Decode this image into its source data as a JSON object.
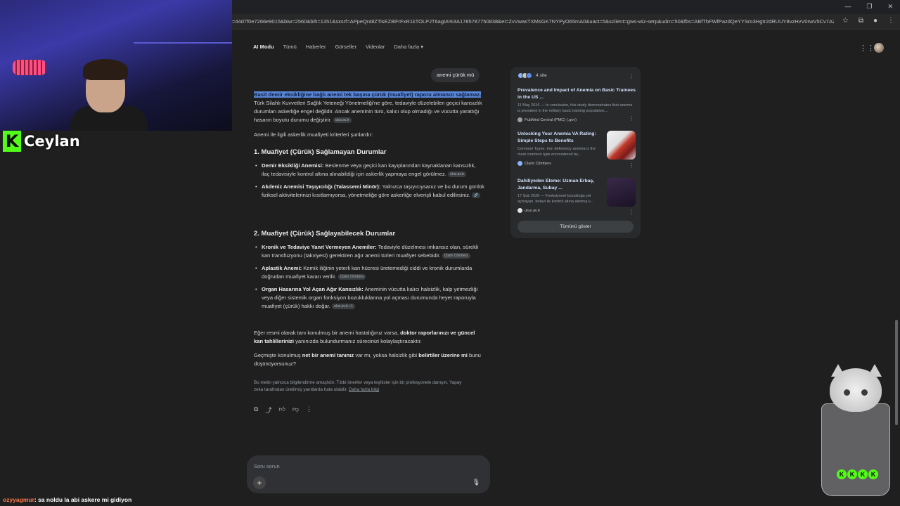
{
  "browser": {
    "url": "=44d7f0e7266e9015&biw=2560&bih=1351&sxsrf=APpeQnt8ZTisEZ8iFrFxR1kTOLPJT6agtA%3A1785787750838&ei=ZvVwasTXMsGK7NYPyO65mA0&uact=5&sclient=gws-wiz-serp&udm=50&fbs=ABfTbFWfPazdQeYYSro3Hgtr2dRUUY8vzHvV0rwV5Cv7AZbSGfhWG5wIUUJkA5_..."
  },
  "nav": {
    "items": [
      "AI Modu",
      "Tümü",
      "Haberler",
      "Görseller",
      "Videolar",
      "Daha fazla"
    ]
  },
  "answer": {
    "user_query": "anemi çürük mü",
    "intro_highlight": "Basit demir eksikliğine bağlı anemi tek başına çürük (muafiyet) raporu almanızı sağlamaz.",
    "intro_rest": " Türk Silahlı Kuvvetleri Sağlık Yeteneği Yönetmeliği'ne göre, tedaviyle düzelebilen geçici kansızlık durumları askerliğe engel değildir. Ancak aneminin türü, kalıcı olup olmadığı ve vücutta yarattığı hasarın boyutu durumu değiştirir.",
    "intro_chip": "ulus.av.tr",
    "lead": "Anemi ile ilgili askerlik muafiyeti kriterleri şunlardır:",
    "section1_title": "1. Muafiyet (Çürük) Sağlamayan Durumlar",
    "section1_items": [
      {
        "bold": "Demir Eksikliği Anemisi:",
        "text": " Beslenme veya geçici kan kayıplarından kaynaklanan kansızlık, ilaç tedavisiyle kontrol altına alınabildiği için askerlik yapmaya engel görülmez.",
        "chip": "ulus.av.tr"
      },
      {
        "bold": "Akdeniz Anemisi Taşıyıcılığı (Talassemi Minör):",
        "text": " Yalnızca taşıyıcıysanız ve bu durum günlük fiziksel aktivitelerinizi kısıtlamıyorsa, yönetmeliğe göre askerliğe elverişli kabul edilirsiniz.",
        "chip": "🔗"
      }
    ],
    "section2_title": "2. Muafiyet (Çürük) Sağlayabilecek Durumlar",
    "section2_items": [
      {
        "bold": "Kronik ve Tedaviye Yanıt Vermeyen Anemiler:",
        "text": " Tedaviyle düzelmesi imkansız olan, sürekli kan transfüzyonu (takviyesi) gerektiren ağır anemi türleri muafiyet sebebidir.",
        "chip": "Claim Climbers"
      },
      {
        "bold": "Aplastik Anemi:",
        "text": " Kemik iliğinin yeterli kan hücresi üretemediği ciddi ve kronik durumlarda doğrudan muafiyet kararı verilir.",
        "chip": "Claim Climbers"
      },
      {
        "bold": "Organ Hasarına Yol Açan Ağır Kansızlık:",
        "text": " Aneminin vücutta kalıcı halsizlik, kalp yetmezliği veya diğer sistemik organ fonksiyon bozukluklarına yol açması durumunda heyet raporuyla muafiyet (çürük) hakkı doğar.",
        "chip": "ulus.av.tr +1"
      }
    ],
    "outro1_a": "Eğer resmi olarak tanı konulmuş bir anemi hastalığınız varsa, ",
    "outro1_b": "doktor raporlarınızı ve güncel kan tahlillerinizi",
    "outro1_c": " yanınızda bulundurmanız sürecinizi kolaylaştıracaktır.",
    "outro2_a": "Geçmişte konulmuş ",
    "outro2_b": "net bir anemi tanınız",
    "outro2_c": " var mı, yoksa halsizlik gibi ",
    "outro2_d": "belirtiler üzerine mi",
    "outro2_e": " bunu düşünüyorsunuz?",
    "disclaimer": "Bu metin yalnızca bilgilendirme amaçlıdır. Tıbbi öneriler veya teşhisler için bir profesyonele danışın. Yapay zeka tarafından üretilmiş yanıtlarda hata olabilir. ",
    "disclaimer_link": "Daha fazla bilgi"
  },
  "ask": {
    "placeholder": "Soru sorun",
    "plus": "+",
    "mic": "🎙"
  },
  "sources": {
    "count_label": "4 site",
    "items": [
      {
        "title": "Prevalence and Impact of Anemia on Basic Trainees in the US ...",
        "snippet": "11 May 2016 — In conclusion, this study demonstrates that anemia is prevalent in the military basic training population,...",
        "site": "PubMed Central (PMC) (.gov)"
      },
      {
        "title": "Unlocking Your Anemia VA Rating: Simple Steps to Benefits",
        "snippet": "Common Types. Iron deficiency anemia is the most common type encountered by...",
        "site": "Claim Climbers"
      },
      {
        "title": "Dahiliyeden Eleme: Uzman Erbaş, Jandarma, Subay ...",
        "snippet": "17 Şub 2026 — Fonksiyonel bozukluğa yol açmayan, tedavi ile kontrol altına alınmış v...",
        "site": "ulus.av.tr"
      }
    ],
    "show_all": "Tümünü göster"
  },
  "stream": {
    "streamer_name": "Ceylan",
    "chat_user": "ozyyagmur",
    "chat_message": ": sa noldu la abi askere mi gidiyon",
    "accent": "#53fc18"
  },
  "colors": {
    "background": "#1f1f1f",
    "highlight": "#5a86d6",
    "link": "#d2e3fc"
  }
}
